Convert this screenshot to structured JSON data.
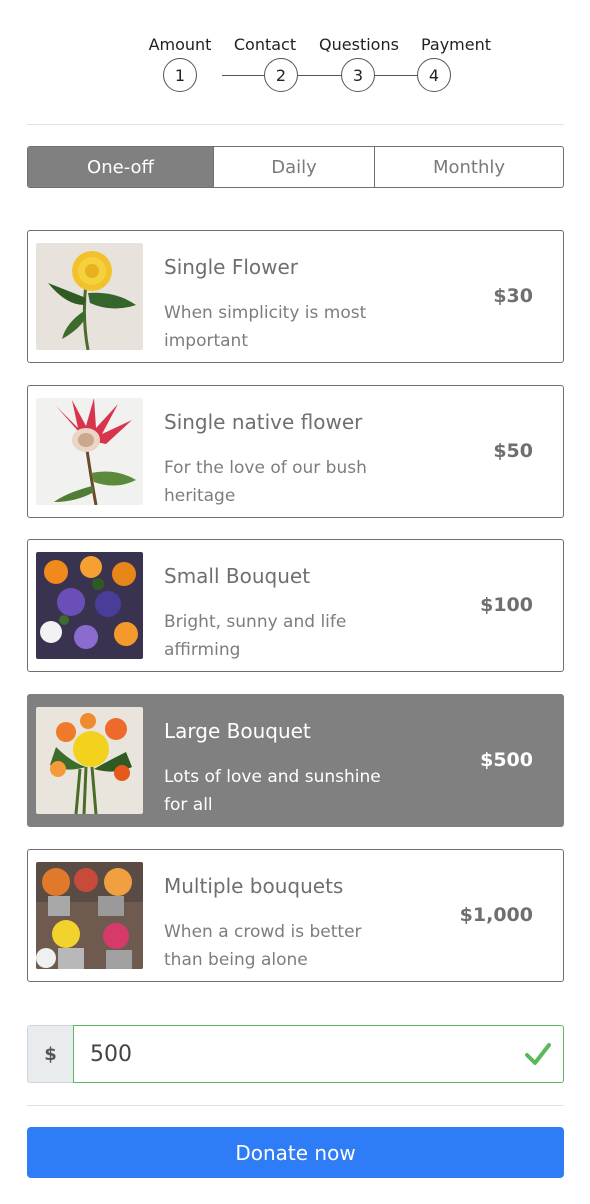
{
  "steps": [
    {
      "label": "Amount",
      "number": "1"
    },
    {
      "label": "Contact",
      "number": "2"
    },
    {
      "label": "Questions",
      "number": "3"
    },
    {
      "label": "Payment",
      "number": "4"
    }
  ],
  "frequency": {
    "tabs": [
      "One-off",
      "Daily",
      "Monthly"
    ],
    "selected": "One-off"
  },
  "options": [
    {
      "title": "Single Flower",
      "description": "When simplicity is most important",
      "price": "$30",
      "image": "yellow-dahlia-photo"
    },
    {
      "title": "Single native flower",
      "description": "For the love of our bush heritage",
      "price": "$50",
      "image": "protea-photo"
    },
    {
      "title": "Small Bouquet",
      "description": "Bright, sunny and life affirming",
      "price": "$100",
      "image": "small-bouquet-photo"
    },
    {
      "title": "Large Bouquet",
      "description": "Lots of love and sunshine for all",
      "price": "$500",
      "image": "large-bouquet-photo",
      "selected": true
    },
    {
      "title": "Multiple bouquets",
      "description": "When a crowd is better than being alone",
      "price": "$1,000",
      "image": "flower-stall-photo"
    }
  ],
  "amount": {
    "currency_symbol": "$",
    "value": "500",
    "valid": true
  },
  "donate_button": {
    "label": "Donate now"
  },
  "colors": {
    "accent": "#2e7cf6",
    "selected": "#808080",
    "valid": "#5cb85c"
  }
}
